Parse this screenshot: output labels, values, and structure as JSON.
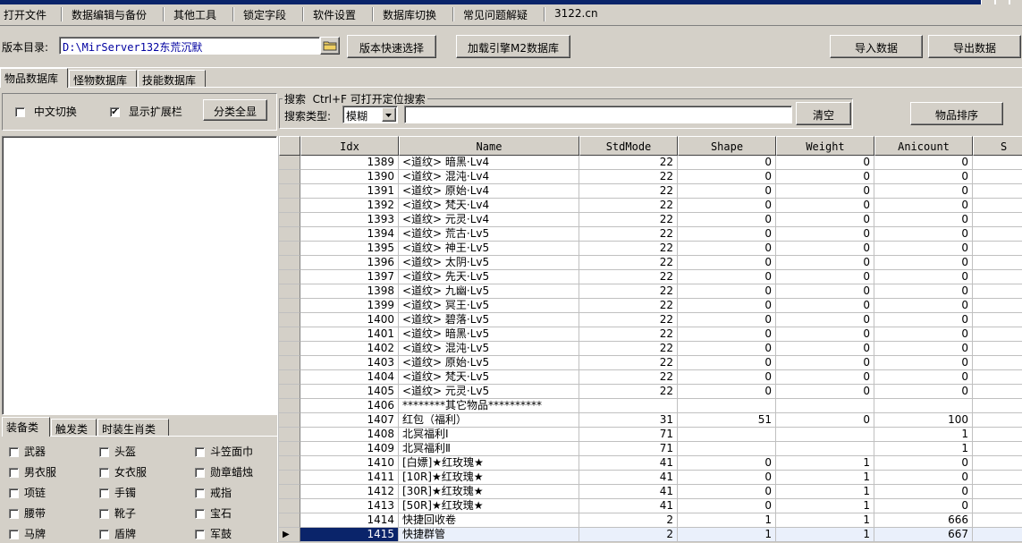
{
  "menu": [
    "打开文件",
    "数据编辑与备份",
    "其他工具",
    "锁定字段",
    "软件设置",
    "数据库切换",
    "常见问题解疑",
    "3122.cn"
  ],
  "version": {
    "label": "版本目录:",
    "path": "D:\\MirServer132东荒沉默",
    "quick_select": "版本快速选择",
    "load_engine": "加载引擎M2数据库",
    "import": "导入数据",
    "export": "导出数据"
  },
  "tabs": [
    "物品数据库",
    "怪物数据库",
    "技能数据库"
  ],
  "options": {
    "chinese_toggle": "中文切换",
    "show_ext": "显示扩展栏",
    "show_ext_checked": "✔",
    "category_all": "分类全显"
  },
  "search": {
    "group_title": "搜索  Ctrl+F 可打开定位搜索",
    "type_label": "搜索类型:",
    "type_value": "模糊",
    "clear": "清空",
    "sort": "物品排序"
  },
  "cat_tabs": [
    "装备类",
    "触发类",
    "时装生肖类"
  ],
  "categories": [
    [
      "武器",
      "头盔",
      "斗笠面巾"
    ],
    [
      "男衣服",
      "女衣服",
      "勋章蜡烛"
    ],
    [
      "项链",
      "手镯",
      "戒指"
    ],
    [
      "腰带",
      "靴子",
      "宝石"
    ],
    [
      "马牌",
      "盾牌",
      "军鼓"
    ]
  ],
  "grid": {
    "columns": [
      "Idx",
      "Name",
      "StdMode",
      "Shape",
      "Weight",
      "Anicount",
      "S"
    ],
    "rows": [
      [
        "1389",
        "<道纹> 暗黑·Lv4",
        "22",
        "0",
        "0",
        "0"
      ],
      [
        "1390",
        "<道纹> 混沌·Lv4",
        "22",
        "0",
        "0",
        "0"
      ],
      [
        "1391",
        "<道纹> 原始·Lv4",
        "22",
        "0",
        "0",
        "0"
      ],
      [
        "1392",
        "<道纹> 梵天·Lv4",
        "22",
        "0",
        "0",
        "0"
      ],
      [
        "1393",
        "<道纹> 元灵·Lv4",
        "22",
        "0",
        "0",
        "0"
      ],
      [
        "1394",
        "<道纹> 荒古·Lv5",
        "22",
        "0",
        "0",
        "0"
      ],
      [
        "1395",
        "<道纹> 神王·Lv5",
        "22",
        "0",
        "0",
        "0"
      ],
      [
        "1396",
        "<道纹> 太阴·Lv5",
        "22",
        "0",
        "0",
        "0"
      ],
      [
        "1397",
        "<道纹> 先天·Lv5",
        "22",
        "0",
        "0",
        "0"
      ],
      [
        "1398",
        "<道纹> 九幽·Lv5",
        "22",
        "0",
        "0",
        "0"
      ],
      [
        "1399",
        "<道纹> 冥王·Lv5",
        "22",
        "0",
        "0",
        "0"
      ],
      [
        "1400",
        "<道纹> 碧落·Lv5",
        "22",
        "0",
        "0",
        "0"
      ],
      [
        "1401",
        "<道纹> 暗黑·Lv5",
        "22",
        "0",
        "0",
        "0"
      ],
      [
        "1402",
        "<道纹> 混沌·Lv5",
        "22",
        "0",
        "0",
        "0"
      ],
      [
        "1403",
        "<道纹> 原始·Lv5",
        "22",
        "0",
        "0",
        "0"
      ],
      [
        "1404",
        "<道纹> 梵天·Lv5",
        "22",
        "0",
        "0",
        "0"
      ],
      [
        "1405",
        "<道纹> 元灵·Lv5",
        "22",
        "0",
        "0",
        "0"
      ],
      [
        "1406",
        "********其它物品**********",
        "",
        "",
        "",
        ""
      ],
      [
        "1407",
        "红包（福利）",
        "31",
        "51",
        "0",
        "100"
      ],
      [
        "1408",
        "北冥福利Ⅰ",
        "71",
        "",
        "",
        "1"
      ],
      [
        "1409",
        "北冥福利Ⅱ",
        "71",
        "",
        "",
        "1"
      ],
      [
        "1410",
        "[白嫖]★红玫瑰★",
        "41",
        "0",
        "1",
        "0"
      ],
      [
        "1411",
        "[10R]★红玫瑰★",
        "41",
        "0",
        "1",
        "0"
      ],
      [
        "1412",
        "[30R]★红玫瑰★",
        "41",
        "0",
        "1",
        "0"
      ],
      [
        "1413",
        "[50R]★红玫瑰★",
        "41",
        "0",
        "1",
        "0"
      ],
      [
        "1414",
        "快捷回收卷",
        "2",
        "1",
        "1",
        "666"
      ],
      [
        "1415",
        "快捷群管",
        "2",
        "1",
        "1",
        "667"
      ]
    ],
    "selected_row": 26,
    "current_marker": "▶"
  },
  "icons": {
    "folder": "folder-icon",
    "dropdown": "chevron-down-icon"
  }
}
